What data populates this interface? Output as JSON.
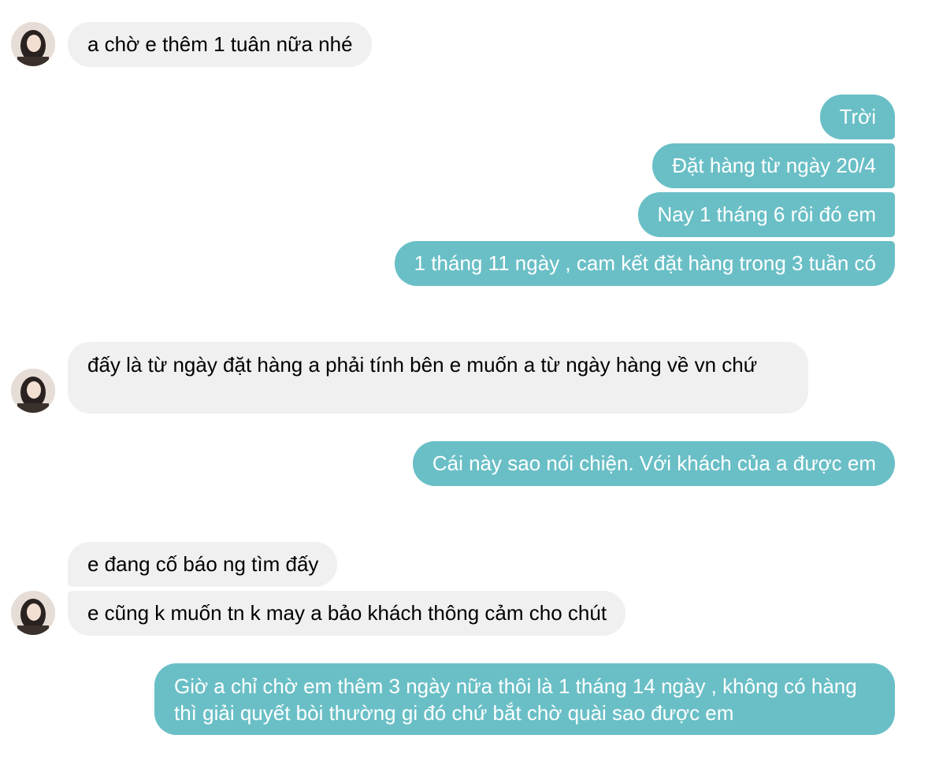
{
  "messages": [
    {
      "from": "them",
      "text": "a chờ e thêm 1 tuân nữa nhé"
    },
    {
      "from": "me",
      "text": "Trời"
    },
    {
      "from": "me",
      "text": "Đặt hàng từ ngày 20/4"
    },
    {
      "from": "me",
      "text": "Nay 1 tháng 6 rôi đó em"
    },
    {
      "from": "me",
      "text": "1 tháng 11 ngày , cam kết đặt hàng trong 3 tuần có"
    },
    {
      "from": "them",
      "text": "đấy là từ ngày đặt hàng a phải tính bên e muốn a từ ngày hàng về vn chứ"
    },
    {
      "from": "me",
      "text": "Cái này sao nói chiện. Với khách của a được em"
    },
    {
      "from": "them",
      "text": "e đang cố báo ng tìm đấy"
    },
    {
      "from": "them",
      "text": "e cũng k muốn tn k may a bảo khách thông cảm cho chút"
    },
    {
      "from": "me",
      "text": "Giờ a chỉ chờ em thêm 3 ngày nữa thôi là 1 tháng 14 ngày , không có hàng thì giải quyết bòi thường gi đó chứ bắt chờ quài sao được em"
    }
  ],
  "colors": {
    "incoming_bubble": "#f0f0f0",
    "outgoing_bubble": "#6abfc6",
    "incoming_text": "#000000",
    "outgoing_text": "#ffffff"
  },
  "icons": {
    "avatar": "contact-avatar-photo"
  }
}
